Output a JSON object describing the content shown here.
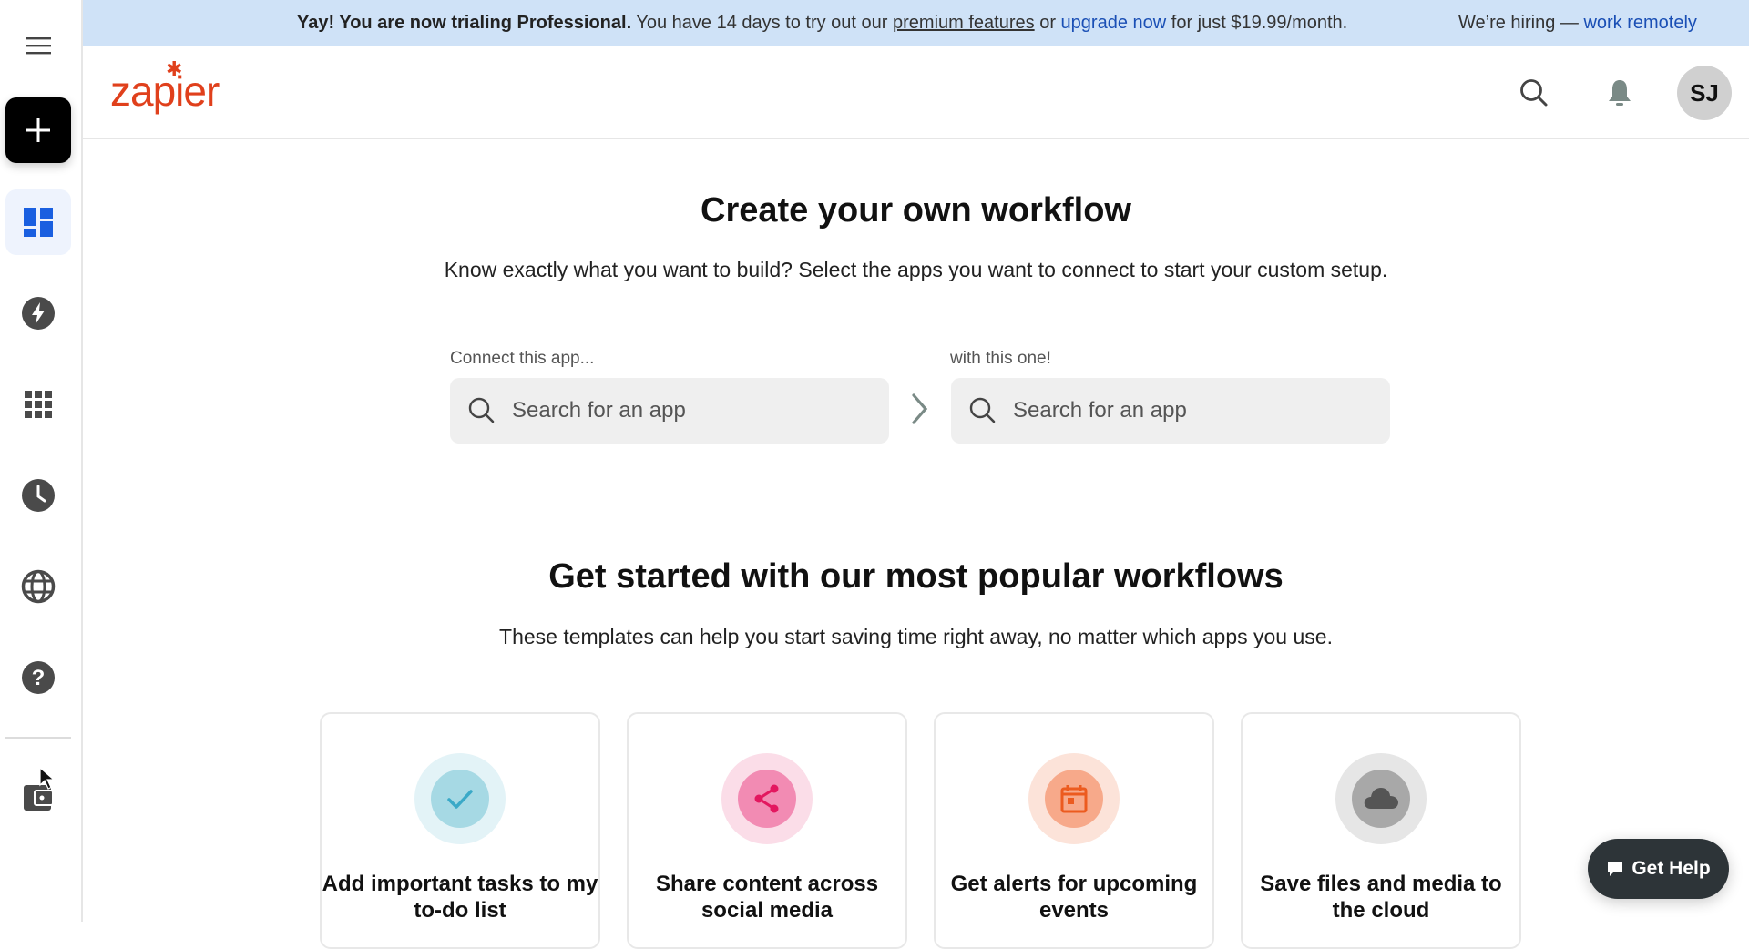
{
  "banner": {
    "bold": "Yay! You are now trialing Professional.",
    "text1": " You have 14 days to try out our ",
    "link_premium": "premium features",
    "text2": " or ",
    "link_upgrade": "upgrade now",
    "text3": " for just $19.99/month.",
    "hiring_text": "We’re hiring — ",
    "hiring_link": "work remotely"
  },
  "sidebar": {
    "items": [
      {
        "name": "menu",
        "icon": "hamburger-icon"
      },
      {
        "name": "create",
        "icon": "plus-icon"
      },
      {
        "name": "dashboard",
        "icon": "dashboard-icon",
        "active": true
      },
      {
        "name": "zaps",
        "icon": "lightning-icon"
      },
      {
        "name": "apps",
        "icon": "grid-icon"
      },
      {
        "name": "history",
        "icon": "clock-icon"
      },
      {
        "name": "explore",
        "icon": "globe-icon"
      },
      {
        "name": "help",
        "icon": "question-icon"
      },
      {
        "name": "billing",
        "icon": "wallet-icon"
      }
    ]
  },
  "header": {
    "logo": "zapier",
    "avatar_initials": "SJ"
  },
  "create": {
    "title": "Create your own workflow",
    "subtitle": "Know exactly what you want to build? Select the apps you want to connect to start your custom setup.",
    "label_from": "Connect this app...",
    "label_to": "with this one!",
    "placeholder": "Search for an app"
  },
  "popular": {
    "title": "Get started with our most popular workflows",
    "subtitle": "These templates can help you start saving time right away, no matter which apps you use.",
    "cards": [
      {
        "title": "Add important tasks to my to-do list",
        "icon": "check-icon",
        "ring": "#e3f3f7",
        "inner": "#a6d9e4",
        "fg": "#3aa9c7"
      },
      {
        "title": "Share content across social media",
        "icon": "share-icon",
        "ring": "#fbdde8",
        "inner": "#f28bb3",
        "fg": "#e3175f"
      },
      {
        "title": "Get alerts for upcoming events",
        "icon": "calendar-icon",
        "ring": "#fce3d9",
        "inner": "#f7a98a",
        "fg": "#ec5b1f"
      },
      {
        "title": "Save files and media to the cloud",
        "icon": "cloud-icon",
        "ring": "#e6e6e6",
        "inner": "#a8a8a8",
        "fg": "#555555"
      }
    ]
  },
  "help_button": "Get Help",
  "colors": {
    "brand": "#e0401c",
    "accent": "#1a5fe0",
    "banner_bg": "#cfe2f7",
    "link": "#1a4fb5"
  }
}
